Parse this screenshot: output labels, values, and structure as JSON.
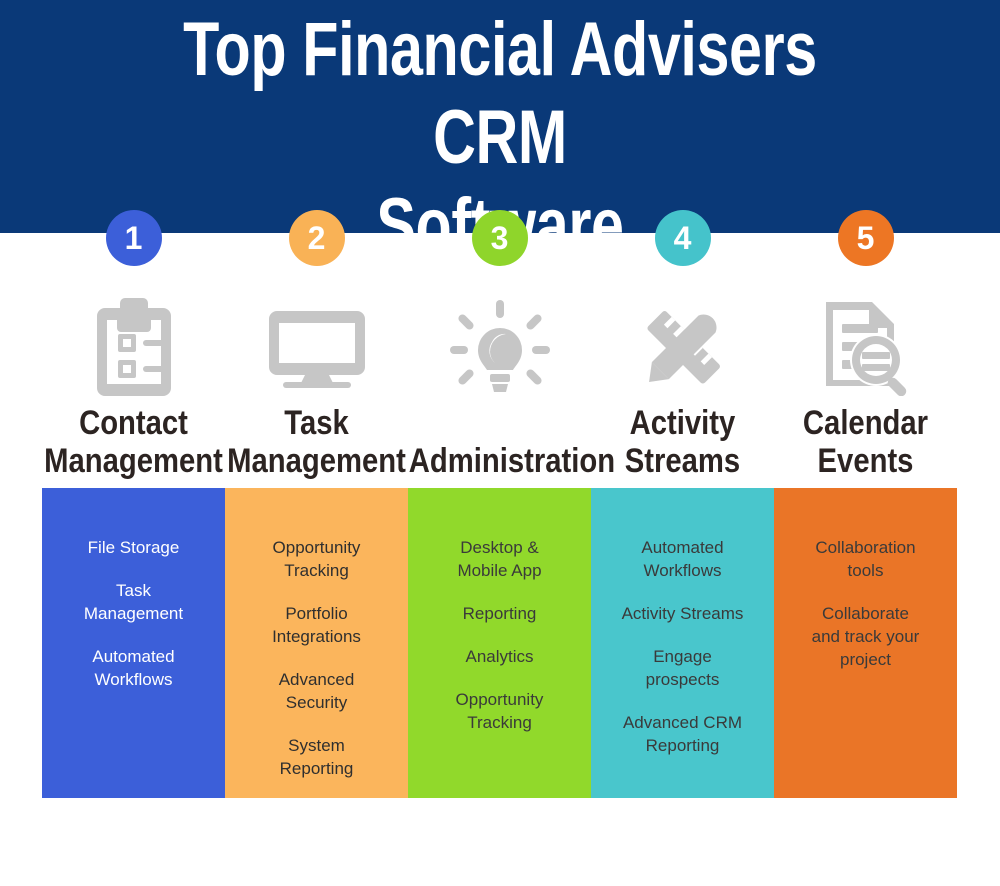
{
  "header": {
    "title": "Top Financial Advisers CRM\nSoftware",
    "background_color": "#0a3978",
    "title_color": "#ffffff"
  },
  "steps": [
    {
      "number": "1",
      "badge_color": "#3c5fd9",
      "icon": "clipboard-checklist-icon",
      "label": "Contact\nManagement"
    },
    {
      "number": "2",
      "badge_color": "#f9b256",
      "icon": "desktop-monitor-icon",
      "label": "Task\nManagement"
    },
    {
      "number": "3",
      "badge_color": "#8fd52b",
      "icon": "lightbulb-idea-icon",
      "label": "Administration"
    },
    {
      "number": "4",
      "badge_color": "#45c3cb",
      "icon": "ruler-pencil-icon",
      "label": "Activity\nStreams"
    },
    {
      "number": "5",
      "badge_color": "#ed7624",
      "icon": "document-search-icon",
      "label": "Calendar Events"
    }
  ],
  "icon_color": "#c6c6c6",
  "columns": [
    {
      "background_color": "#3c5fd9",
      "text_color": "#ffffff",
      "items": [
        "File Storage",
        "Task\nManagement",
        "Automated\nWorkflows"
      ]
    },
    {
      "background_color": "#fbb55c",
      "text_color": "#2f2f2f",
      "items": [
        "Opportunity\nTracking",
        "Portfolio\nIntegrations",
        "Advanced\nSecurity",
        "System\nReporting"
      ]
    },
    {
      "background_color": "#91d92b",
      "text_color": "#3a3a3a",
      "items": [
        "Desktop &\nMobile App",
        "Reporting",
        "Analytics",
        "Opportunity\nTracking"
      ]
    },
    {
      "background_color": "#49c6cc",
      "text_color": "#3a3a3a",
      "items": [
        "Automated\nWorkflows",
        "Activity Streams",
        "Engage\nprospects",
        "Advanced CRM\nReporting"
      ]
    },
    {
      "background_color": "#ea7527",
      "text_color": "#3a3a3a",
      "items": [
        "Collaboration\ntools",
        "Collaborate\nand track your\nproject"
      ]
    }
  ]
}
